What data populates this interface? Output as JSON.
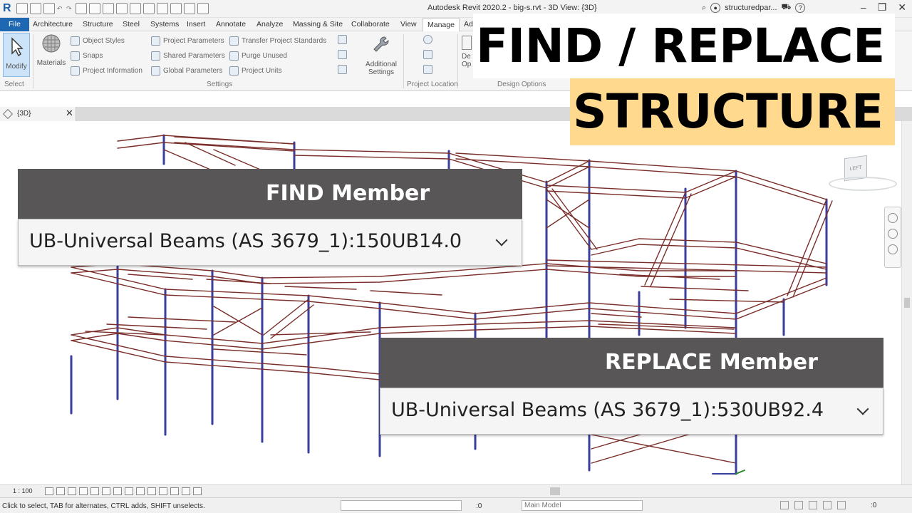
{
  "window": {
    "title": "Autodesk Revit 2020.2 - big-s.rvt - 3D View: {3D}",
    "user": "structuredpar...",
    "help": "?"
  },
  "ribbon_tabs": [
    "File",
    "Architecture",
    "Structure",
    "Steel",
    "Systems",
    "Insert",
    "Annotate",
    "Analyze",
    "Massing & Site",
    "Collaborate",
    "View",
    "Manage",
    "Ad"
  ],
  "ribbon": {
    "modify_label": "Modify",
    "materials_label": "Materials",
    "settings_col1": [
      "Object Styles",
      "Snaps",
      "Project Information"
    ],
    "settings_col2": [
      "Project Parameters",
      "Shared Parameters",
      "Global Parameters"
    ],
    "settings_col3": [
      "Transfer Project Standards",
      "Purge Unused",
      "Project Units"
    ],
    "additional_settings_label": "Additional Settings",
    "design_options_partial": "De Op",
    "groups": {
      "select": "Select",
      "settings": "Settings",
      "project_location": "Project Location",
      "design_options": "Design Options"
    }
  },
  "view_tab": {
    "label": "{3D}",
    "close": "✕"
  },
  "viewcube": {
    "face": "LEFT"
  },
  "headline": {
    "line1": "FIND / REPLACE",
    "line2": "STRUCTURE"
  },
  "find": {
    "header": "FIND Member",
    "value": "UB-Universal Beams (AS 3679_1):150UB14.0"
  },
  "replace": {
    "header": "REPLACE Member",
    "value": "UB-Universal Beams (AS 3679_1):530UB92.4"
  },
  "view_control": {
    "scale": "1 : 100"
  },
  "statusbar": {
    "message": "Click to select, TAB for alternates, CTRL adds, SHIFT unselects.",
    "workset_count": ":0",
    "model": "Main Model",
    "filter_count": ":0"
  },
  "colors": {
    "beam": "#7a2e2a",
    "column": "#3a3f9e",
    "file_tab": "#1e67b2",
    "card_header": "#585656",
    "highlight": "#ffd98e"
  }
}
